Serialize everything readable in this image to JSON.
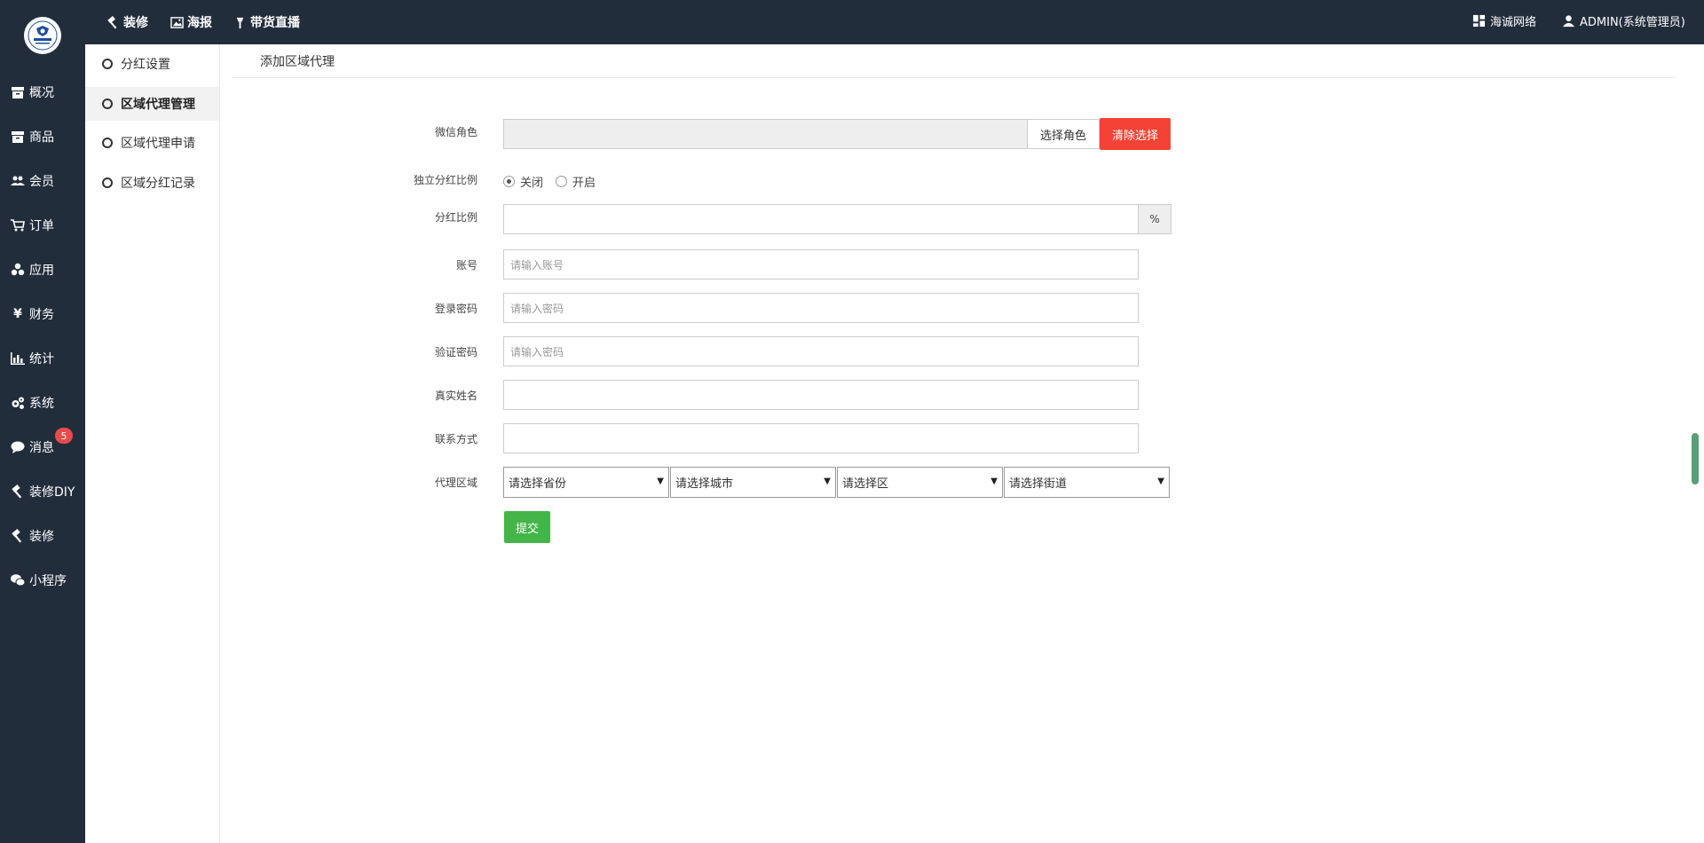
{
  "leftnav": {
    "logo_icon": "brand-logo",
    "items": [
      {
        "label": "概况",
        "icon": "archive-icon"
      },
      {
        "label": "商品",
        "icon": "box-icon"
      },
      {
        "label": "会员",
        "icon": "users-icon"
      },
      {
        "label": "订单",
        "icon": "cart-icon"
      },
      {
        "label": "应用",
        "icon": "apps-icon"
      },
      {
        "label": "财务",
        "icon": "yen-icon"
      },
      {
        "label": "统计",
        "icon": "bar-chart-icon"
      },
      {
        "label": "系统",
        "icon": "gears-icon"
      },
      {
        "label": "消息",
        "icon": "chat-icon",
        "badge": "5"
      },
      {
        "label": "装修DIY",
        "icon": "hammer-icon"
      },
      {
        "label": "装修",
        "icon": "hammer-icon"
      },
      {
        "label": "小程序",
        "icon": "wechat-icon"
      }
    ]
  },
  "topbar": {
    "items": [
      {
        "label": "装修",
        "icon": "hammer-icon"
      },
      {
        "label": "海报",
        "icon": "image-icon"
      },
      {
        "label": "带货直播",
        "icon": "torch-icon"
      }
    ],
    "company": "海诚网络",
    "user": "ADMIN(系统管理员)"
  },
  "submenu": {
    "items": [
      {
        "label": "分红设置",
        "active": false
      },
      {
        "label": "区域代理管理",
        "active": true
      },
      {
        "label": "区域代理申请",
        "active": false
      },
      {
        "label": "区域分红记录",
        "active": false
      }
    ]
  },
  "page": {
    "title": "添加区域代理"
  },
  "form": {
    "wechat_role_label": "微信角色",
    "wechat_role_value": "",
    "select_role_button": "选择角色",
    "clear_select_button": "清除选择",
    "independent_ratio_label": "独立分红比例",
    "radio_off": "关闭",
    "radio_on": "开启",
    "radio_selected": "关闭",
    "ratio_label": "分红比例",
    "ratio_value": "",
    "ratio_addon": "%",
    "account_label": "账号",
    "account_placeholder": "请输入账号",
    "password_label": "登录密码",
    "password_placeholder": "请输入密码",
    "verify_password_label": "验证密码",
    "verify_password_placeholder": "请输入密码",
    "real_name_label": "真实姓名",
    "real_name_value": "",
    "contact_label": "联系方式",
    "contact_value": "",
    "region_label": "代理区域",
    "province_select": "请选择省份",
    "city_select": "请选择城市",
    "district_select": "请选择区",
    "street_select": "请选择街道",
    "submit_button": "提交"
  },
  "colors": {
    "nav_bg": "#222d3c",
    "danger": "#f44336",
    "success": "#44b549",
    "badge": "#e94b4b"
  }
}
